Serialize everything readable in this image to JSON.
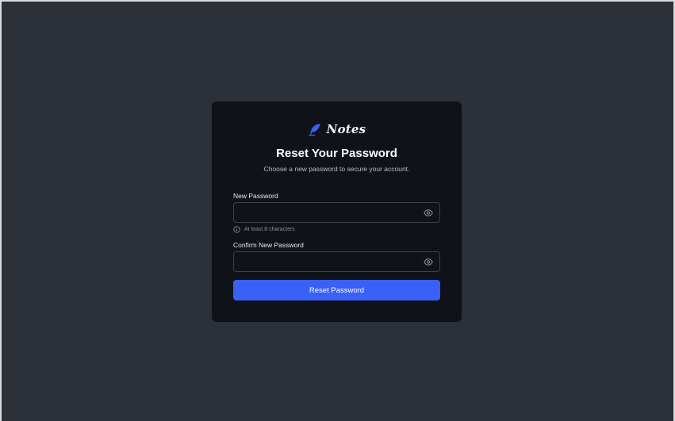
{
  "brand": {
    "name": "Notes",
    "accent_color": "#3a60f7",
    "icon": "feather-quill-icon"
  },
  "heading": {
    "title": "Reset Your Password",
    "subtitle": "Choose a new password to secure your account."
  },
  "new_password": {
    "label": "New Password",
    "value": "",
    "placeholder": "",
    "toggle_icon": "eye-icon",
    "hint_icon": "info-icon",
    "hint": "At least 8 characters"
  },
  "confirm_password": {
    "label": "Confirm New Password",
    "value": "",
    "placeholder": "",
    "toggle_icon": "eye-icon"
  },
  "submit": {
    "label": "Reset Password"
  },
  "colors": {
    "page_background": "#2c3039",
    "card_background": "#0f1219",
    "field_border": "#3a404c",
    "button": "#3a60f7"
  }
}
